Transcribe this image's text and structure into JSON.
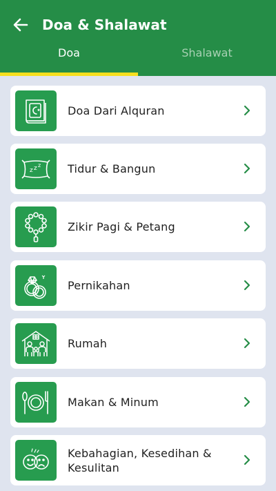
{
  "header": {
    "title": "Doa & Shalawat",
    "back_icon": "arrow-left-icon"
  },
  "tabs": [
    {
      "label": "Doa",
      "active": true
    },
    {
      "label": "Shalawat",
      "active": false
    }
  ],
  "colors": {
    "primary": "#258d47",
    "icon_bg": "#279c4f",
    "indicator": "#f7df1e",
    "background": "#dfe4ef",
    "chevron": "#258d47"
  },
  "items": [
    {
      "label": "Doa Dari Alquran",
      "icon": "quran-book-icon"
    },
    {
      "label": "Tidur & Bangun",
      "icon": "pillow-sleep-icon"
    },
    {
      "label": "Zikir Pagi & Petang",
      "icon": "prayer-beads-icon"
    },
    {
      "label": "Pernikahan",
      "icon": "wedding-rings-icon"
    },
    {
      "label": "Rumah",
      "icon": "family-house-icon"
    },
    {
      "label": "Makan & Minum",
      "icon": "plate-cutlery-icon"
    },
    {
      "label": "Kebahagian, Kesedihan & Kesulitan",
      "icon": "happy-sad-faces-icon"
    }
  ]
}
